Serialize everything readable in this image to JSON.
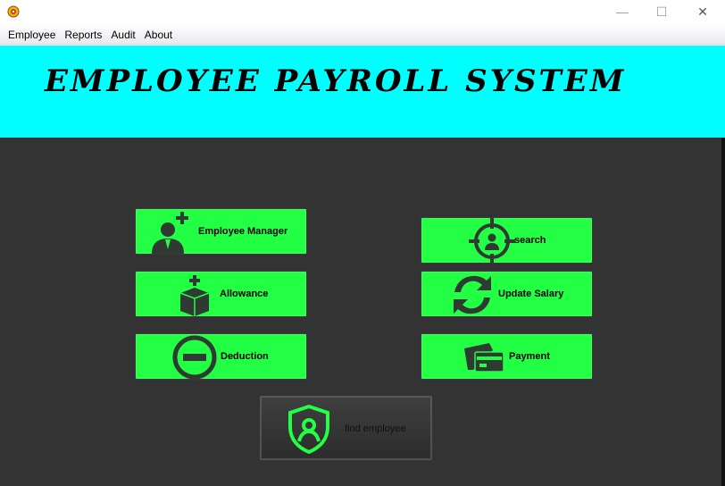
{
  "window": {
    "app_icon": "java-cup-icon",
    "minimize_label": "—",
    "maximize_label": "☐",
    "close_label": "✕"
  },
  "menu": {
    "items": [
      "Employee",
      "Reports",
      "Audit",
      "About"
    ]
  },
  "header": {
    "title": "EMPLOYEE PAYROLL SYSTEM",
    "background": "#00ffff"
  },
  "buttons": {
    "employee_manager": {
      "label": "Employee Manager",
      "icon": "add-user-icon"
    },
    "allowance": {
      "label": "Allowance",
      "icon": "add-box-icon"
    },
    "deduction": {
      "label": "Deduction",
      "icon": "minus-circle-icon"
    },
    "search": {
      "label": "search",
      "icon": "target-person-icon"
    },
    "update_salary": {
      "label": "Update Salary",
      "icon": "refresh-icon"
    },
    "payment": {
      "label": "Payment",
      "icon": "card-icon"
    },
    "find_employee": {
      "label": "find employee",
      "icon": "shield-user-icon"
    }
  },
  "colors": {
    "button_green": "#22ff44",
    "panel_bg": "#333333",
    "icon_dark": "#2f3a32"
  }
}
